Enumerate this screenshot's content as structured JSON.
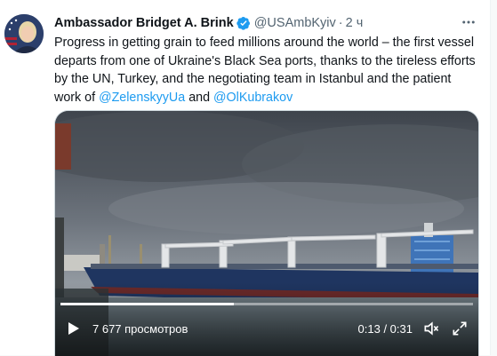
{
  "tweet": {
    "author_name": "Ambassador Bridget A. Brink",
    "handle": "@USAmbKyiv",
    "separator": "·",
    "time": "2 ч",
    "more_icon": "more-horizontal-icon",
    "verified_icon": "verified-badge-icon",
    "text_part1": "Progress in getting grain to feed millions around the world – the first vessel departs from one of Ukraine's Black Sea ports, thanks to the tireless efforts by the UN, Turkey, and the negotiating team in Istanbul and the patient work of ",
    "mention1": "@ZelenskyyUa",
    "text_and": " and ",
    "mention2": "@OlKubrakov"
  },
  "video": {
    "views": "7 677 просмотров",
    "timecode": "0:13 / 0:31",
    "progress": 0.42,
    "play_icon": "play-icon",
    "mute_icon": "muted-speaker-icon",
    "fullscreen_icon": "fullscreen-icon"
  },
  "colors": {
    "accent": "#1d9bf0",
    "text": "#0f1419",
    "secondary": "#536471"
  }
}
